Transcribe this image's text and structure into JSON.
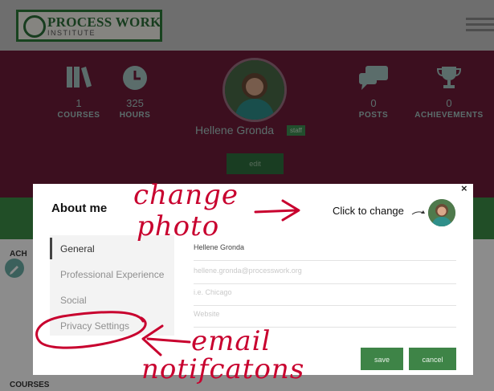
{
  "header": {
    "logo_text_main": "PROCESS WORK",
    "logo_text_sub": "INSTITUTE"
  },
  "profile": {
    "stats": [
      {
        "value": "1",
        "label": "COURSES",
        "icon": "books-icon"
      },
      {
        "value": "325",
        "label": "HOURS",
        "icon": "clock-icon"
      },
      {
        "value": "0",
        "label": "POSTS",
        "icon": "chat-bubbles-icon"
      },
      {
        "value": "0",
        "label": "ACHIEVEMENTS",
        "icon": "trophy-icon"
      }
    ],
    "name": "Hellene Gronda",
    "badge": "staff",
    "edit_label": "edit"
  },
  "background_page": {
    "section_label_left": "ACH",
    "partial_letter": "I",
    "courses_label": "COURSES"
  },
  "modal": {
    "title": "About me",
    "change_photo_text": "Click to change",
    "nav": [
      "General",
      "Professional Experience",
      "Social",
      "Privacy Settings"
    ],
    "active_nav": "General",
    "fields": {
      "name": {
        "value": "Hellene Gronda",
        "placeholder": ""
      },
      "email": {
        "value": "",
        "placeholder": "hellene.gronda@processwork.org"
      },
      "location": {
        "value": "",
        "placeholder": "i.e. Chicago"
      },
      "website": {
        "value": "",
        "placeholder": "Website"
      }
    },
    "save_label": "save",
    "cancel_label": "cancel",
    "close_glyph": "×"
  },
  "annotations": {
    "change_photo_1": "change",
    "change_photo_2": "photo",
    "email_1": "email",
    "email_2": "notifcatons"
  },
  "colors": {
    "banner": "#6e1d3a",
    "accent_green": "#3e8447",
    "annotation_red": "#c8002e"
  }
}
